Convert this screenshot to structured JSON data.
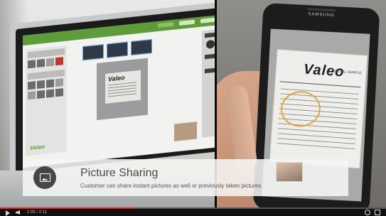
{
  "video": {
    "caption_title": "Picture Sharing",
    "caption_subtitle": "Customer can share instant pictures as well or previously taken pictures",
    "laptop_app_logo": "Valeo",
    "laptop_photo_brand": "Valeo",
    "phone_brand": "SAMSUNG",
    "phone_label_brand": "Valeo",
    "phone_label_tag": "INITIAL SAMPLE",
    "time": "1:05 / 2:11",
    "progress": 0.35,
    "accent_color": "#e62117"
  },
  "icons": {
    "caption_badge": "picture-icon",
    "play": "play-icon",
    "volume": "volume-icon",
    "settings": "gear-icon",
    "fullscreen": "fullscreen-icon"
  }
}
